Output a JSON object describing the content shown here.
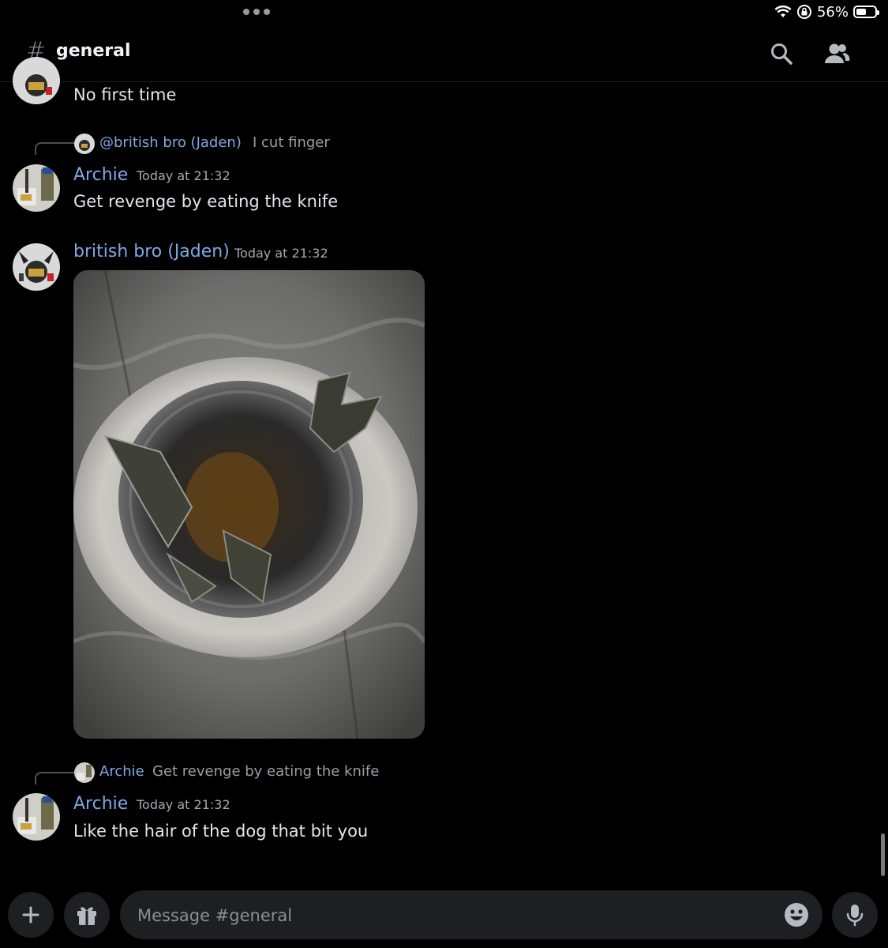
{
  "status_bar": {
    "battery_text": "56%",
    "battery_level": 0.56
  },
  "header": {
    "hash": "#",
    "channel_name": "general"
  },
  "messages": [
    {
      "id": "m0",
      "text": "No first time"
    },
    {
      "id": "m1",
      "reply": {
        "name": "@british bro (Jaden)",
        "text": "I cut finger"
      },
      "author": "Archie",
      "timestamp": "Today at 21:32",
      "text": "Get revenge by eating the knife"
    },
    {
      "id": "m2",
      "author": "british bro (Jaden)",
      "timestamp": "Today at 21:32",
      "attachment": "image"
    },
    {
      "id": "m3",
      "reply": {
        "name": "Archie",
        "text": "Get revenge by eating the knife"
      },
      "author": "Archie",
      "timestamp": "Today at 21:32",
      "text": "Like the hair of the dog that bit you"
    }
  ],
  "composer": {
    "placeholder": "Message #general"
  },
  "icons": {
    "search": "search-icon",
    "members": "members-icon",
    "add": "plus-icon",
    "gift": "gift-icon",
    "emoji": "emoji-icon",
    "mic": "microphone-icon"
  },
  "colors": {
    "username": "#7ea8e3",
    "background": "#000000",
    "input_bg": "#1e1f22"
  }
}
